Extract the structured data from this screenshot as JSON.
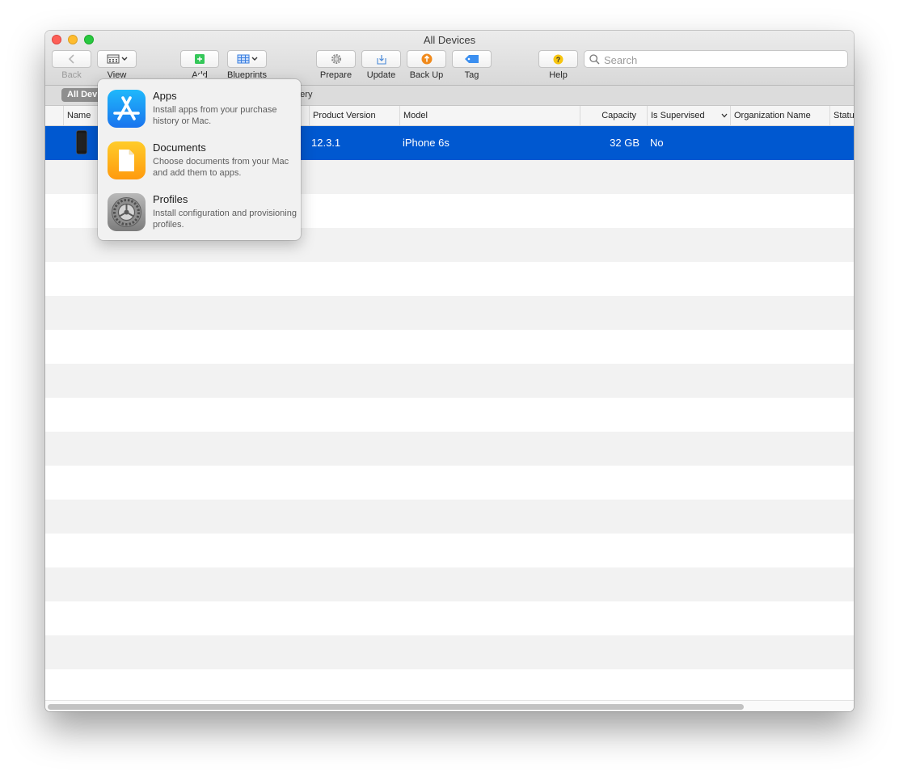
{
  "window": {
    "title": "All Devices"
  },
  "toolbar": {
    "back_label": "Back",
    "view_label": "View",
    "add_label": "Add",
    "blueprints_label": "Blueprints",
    "prepare_label": "Prepare",
    "update_label": "Update",
    "backup_label": "Back Up",
    "tag_label": "Tag",
    "help_label": "Help",
    "search_placeholder": "Search"
  },
  "filters": {
    "active": "All Devices",
    "other": "Recovery"
  },
  "table": {
    "columns": [
      "Name",
      "Product Version",
      "Model",
      "Capacity",
      "Is Supervised",
      "Organization Name",
      "Status"
    ],
    "rows": [
      {
        "product_version": "12.3.1",
        "model": "iPhone 6s",
        "capacity": "32 GB",
        "is_supervised": "No",
        "selected": true
      }
    ]
  },
  "add_menu": {
    "items": [
      {
        "title": "Apps",
        "description": "Install apps from your purchase history or Mac.",
        "icon": "app-store-icon"
      },
      {
        "title": "Documents",
        "description": "Choose documents from your Mac and add them to apps.",
        "icon": "document-icon"
      },
      {
        "title": "Profiles",
        "description": "Install configuration and provisioning profiles.",
        "icon": "settings-gear-icon"
      }
    ]
  },
  "colors": {
    "selection": "#0058d0",
    "accent_green": "#34c759",
    "backup_orange": "#f08a1c",
    "tag_blue": "#3b8ff0"
  }
}
